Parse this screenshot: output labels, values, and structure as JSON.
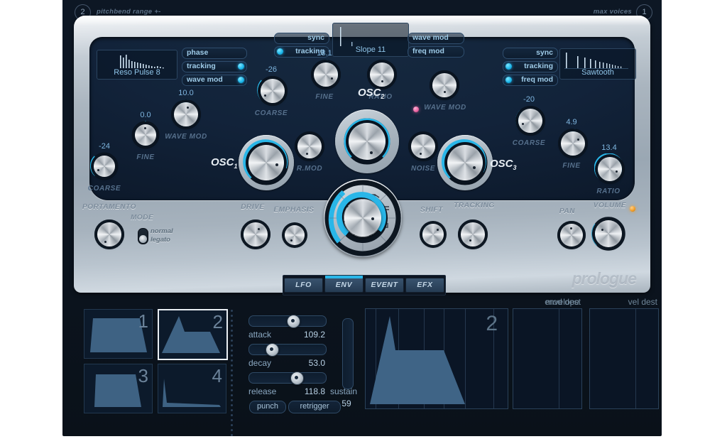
{
  "app": {
    "name": "prologue",
    "logo": "prologue"
  },
  "topbar": {
    "left_badge": "2",
    "left_label": "pitchbend range +-",
    "right_label": "max voices",
    "right_badge": "1"
  },
  "osc1": {
    "name": "OSC",
    "index": "1",
    "wave_name": "Reso Pulse 8",
    "buttons": [
      {
        "label": "phase",
        "led": false
      },
      {
        "label": "tracking",
        "led": true
      },
      {
        "label": "wave mod",
        "led": true
      }
    ],
    "knobs": [
      {
        "label": "COARSE",
        "value": "-24"
      },
      {
        "label": "FINE",
        "value": "0.0"
      },
      {
        "label": "WAVE MOD",
        "value": "10.0"
      }
    ]
  },
  "osc2": {
    "name": "OSC",
    "index": "2",
    "wave_name": "Slope 11",
    "buttons_left": [
      {
        "label": "sync",
        "led": false
      },
      {
        "label": "tracking",
        "led": true
      }
    ],
    "buttons_right": [
      {
        "label": "wave mod",
        "led": false
      },
      {
        "label": "freq mod",
        "led": false
      }
    ],
    "knobs": [
      {
        "label": "COARSE",
        "value": "-26"
      },
      {
        "label": "FINE",
        "value": "18.1"
      },
      {
        "label": "RATIO",
        "value": ""
      },
      {
        "label": "WAVE MOD",
        "value": ""
      }
    ]
  },
  "osc3": {
    "name": "OSC",
    "index": "3",
    "wave_name": "Sawtooth",
    "buttons": [
      {
        "label": "sync",
        "led": false
      },
      {
        "label": "tracking",
        "led": true
      },
      {
        "label": "freq mod",
        "led": true
      }
    ],
    "knobs": [
      {
        "label": "COARSE",
        "value": "-20"
      },
      {
        "label": "FINE",
        "value": "4.9"
      },
      {
        "label": "RATIO",
        "value": "13.4"
      }
    ]
  },
  "mixer": {
    "rmod_label": "R.MOD",
    "noise_label": "NOISE",
    "noise_led_color": "#e8619f"
  },
  "performance": {
    "portamento_label": "PORTAMENTO",
    "mode_label": "MODE",
    "mode_options": [
      "normal",
      "legato"
    ],
    "mode_selected": "legato",
    "drive_label": "DRIVE",
    "emphasis_label": "EMPHASIS",
    "shift_label": "SHIFT",
    "tracking_label": "TRACKING",
    "pan_label": "PAN",
    "volume_label": "VOLUME",
    "volume_led_color": "#f09a22"
  },
  "tabs": [
    {
      "label": "LFO",
      "active": false
    },
    {
      "label": "ENV",
      "active": true
    },
    {
      "label": "EVENT",
      "active": false
    },
    {
      "label": "EFX",
      "active": false
    }
  ],
  "env_presets": [
    {
      "num": "1",
      "selected": false
    },
    {
      "num": "2",
      "selected": true
    },
    {
      "num": "3",
      "selected": false
    },
    {
      "num": "4",
      "selected": false
    }
  ],
  "envelope_controls": {
    "attack": {
      "label": "attack",
      "value": "109.2",
      "pos_pct": 54
    },
    "decay": {
      "label": "decay",
      "value": "53.0",
      "pos_pct": 26
    },
    "release": {
      "label": "release",
      "value": "118.8",
      "pos_pct": 59
    },
    "sustain": {
      "label": "sustain",
      "value": "59",
      "pos_pct": 59
    },
    "punch": {
      "label": "punch"
    },
    "retrigger": {
      "label": "retrigger"
    }
  },
  "displays": {
    "envelope": {
      "title": "envelope",
      "number": "2"
    },
    "mod_dest": {
      "title": "mod dest"
    },
    "vel_dest": {
      "title": "vel dest"
    }
  },
  "colors": {
    "accent": "#29b6e8",
    "panel_dark": "#0c1521",
    "silver": "#aab5bf",
    "text_blue": "#7fb6e0"
  }
}
